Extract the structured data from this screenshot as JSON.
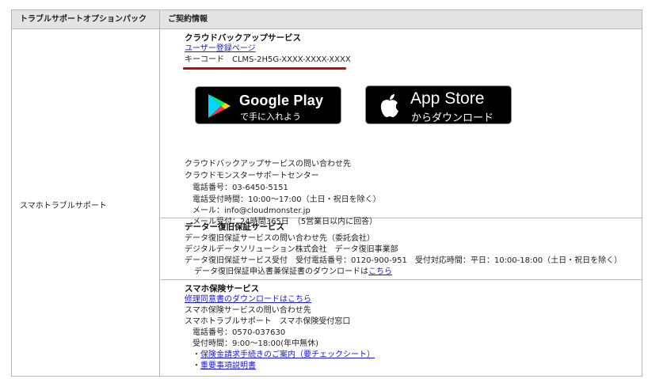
{
  "header": {
    "col1": "トラブルサポートオプションパック",
    "col2": "ご契約情報"
  },
  "left_label": "スマホトラブルサポート",
  "cloud": {
    "title": "クラウドバックアップサービス",
    "user_link": "ユーザー登録ページ",
    "keycode": "キーコード　CLMS-2H5G-XXXX-XXXX-XXXX",
    "google_play": {
      "line1": "Google Play",
      "line2": "で手に入れよう"
    },
    "app_store": {
      "line1": "App Store",
      "line2": "からダウンロード"
    },
    "contact_title": "クラウドバックアップサービスの問い合わせ先",
    "center": "クラウドモンスターサポートセンター",
    "phone": "電話番号：03-6450-5151",
    "hours": "電話受付時間：10:00～17:00（土日・祝日を除く）",
    "mail": "メール：info@cloudmonster.jp",
    "mail_hours": "メール受付：24時間365日　（5営業日以内に回答）"
  },
  "data_recovery": {
    "title": "データー復旧保証サービス",
    "contact": "データ復旧保証サービスの問い合わせ先（委託会社）",
    "company": "デジタルデータソリューション株式会社　データ復旧事業部",
    "reception": "データ復旧保証サービス受付　受付電話番号：0120-900-951　受付対応時間：平日：10:00-18:00（土日・祝日を除く）",
    "download_text": "データ復旧保証申込書兼保証書のダウンロードは",
    "download_link": "こちら"
  },
  "insurance": {
    "title": "スマホ保険サービス",
    "repair_link": "修理同意書のダウンロードはこちら",
    "contact": "スマホ保険サービスの問い合わせ先",
    "desk": "スマホトラブルサポート　スマホ保険受付窓口",
    "phone": "電話番号：0570-037630",
    "hours": "受付時間：9:00～18:00(年中無休)",
    "claim_link": "保険金請求手続きのご案内（要チェックシート）",
    "important_link": "重要事項説明書",
    "bullet": "・"
  }
}
